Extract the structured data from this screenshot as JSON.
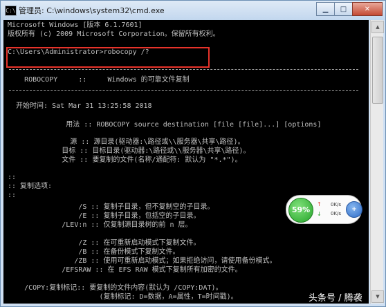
{
  "window": {
    "title": "管理员: C:\\windows\\system32\\cmd.exe",
    "icon_text": "C:\\",
    "controls": {
      "minimize": "▁",
      "maximize": "□",
      "close": "✕"
    }
  },
  "console": {
    "lines": [
      "Microsoft Windows [版本 6.1.7601]",
      "版权所有 (c) 2009 Microsoft Corporation。保留所有权利。",
      "",
      "C:\\Users\\Administrator>robocopy /?",
      "",
      "    ROBOCOPY     ::     Windows 的可靠文件复制",
      "",
      "  开始时间: Sat Mar 31 13:25:58 2018",
      "",
      "              用法 :: ROBOCOPY source destination [file [file]...] [options]",
      "",
      "               源 :: 源目录(驱动器:\\路径或\\\\服务器\\共享\\路径)。",
      "             目标 :: 目标目录(驱动器:\\路径或\\\\服务器\\共享\\路径)。",
      "             文件 :: 要复制的文件(名称/通配符: 默认为 \"*.*\")。",
      "",
      "::",
      ":: 复制选项:",
      "::",
      "                 /S :: 复制子目录，但不复制空的子目录。",
      "                 /E :: 复制子目录，包括空的子目录。",
      "             /LEV:n :: 仅复制源目录树的前 n 层。",
      "",
      "                 /Z :: 在可重新启动模式下复制文件。",
      "                 /B :: 在备份模式下复制文件。",
      "                /ZB :: 使用可重新启动模式；如果拒绝访问，请使用备份模式。",
      "             /EFSRAW :: 在 EFS RAW 模式下复制所有加密的文件。",
      "",
      "    /COPY:复制标记:: 要复制的文件内容(默认为 /COPY:DAT)。",
      "                      (复制标记: D=数据，A=属性，T=时间戳)。"
    ]
  },
  "network_widget": {
    "percent": "59%",
    "upload": "0K/s",
    "download": "0K/s",
    "button_icon": "+"
  },
  "watermark": "头条号 / 腾袭",
  "colors": {
    "console_bg": "#000000",
    "console_text": "#c0c0c0",
    "highlight_box": "#e8332a",
    "widget_green": "#26a52a"
  }
}
